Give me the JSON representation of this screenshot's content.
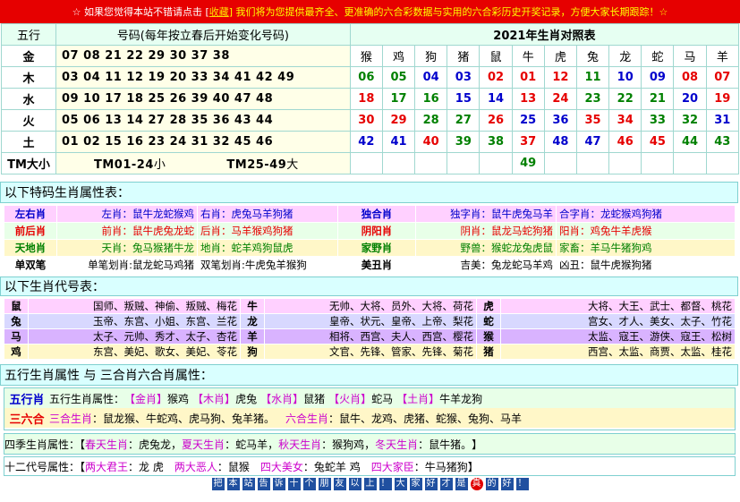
{
  "banner": {
    "prefix": "☆ 如果您觉得本站不错请点击 [",
    "link": "收藏",
    "suffix": "] 我们将为您提供最齐全、更准确的六合彩数据与实用的六合彩历史开奖记录，方便大家长期跟踪！☆"
  },
  "table1": {
    "header": {
      "wuxing": "五行",
      "numbers": "号码(每年按立春后开始变化号码)",
      "year": "2021年生肖对照表"
    },
    "zodiacs": [
      "猴",
      "鸡",
      "狗",
      "猪",
      "鼠",
      "牛",
      "虎",
      "兔",
      "龙",
      "蛇",
      "马",
      "羊"
    ],
    "rows": [
      {
        "wx": "金",
        "nums": "07 08 21 22 29 30 37 38"
      },
      {
        "wx": "木",
        "nums": "03 04 11 12 19 20 33 34 41 42 49"
      },
      {
        "wx": "水",
        "nums": "09 10 17 18 25 26 39 40 47 48"
      },
      {
        "wx": "火",
        "nums": "05 06 13 14 27 28 35 36 43 44"
      },
      {
        "wx": "土",
        "nums": "01 02 15 16 23 24 31 32 45 46"
      }
    ],
    "yearnums": [
      [
        "06",
        "05",
        "04",
        "03",
        "02",
        "01",
        "12",
        "11",
        "10",
        "09",
        "08",
        "07"
      ],
      [
        "18",
        "17",
        "16",
        "15",
        "14",
        "13",
        "24",
        "23",
        "22",
        "21",
        "20",
        "19"
      ],
      [
        "30",
        "29",
        "28",
        "27",
        "26",
        "25",
        "36",
        "35",
        "34",
        "33",
        "32",
        "31"
      ],
      [
        "42",
        "41",
        "40",
        "39",
        "38",
        "37",
        "48",
        "47",
        "46",
        "45",
        "44",
        "43"
      ],
      [
        "",
        "",
        "",
        "",
        "",
        "49",
        "",
        "",
        "",
        "",
        "",
        ""
      ]
    ],
    "yearcolors": [
      [
        "g",
        "g",
        "b",
        "b",
        "r",
        "r",
        "r",
        "g",
        "b",
        "b",
        "r",
        "r"
      ],
      [
        "r",
        "g",
        "g",
        "b",
        "b",
        "r",
        "r",
        "g",
        "g",
        "g",
        "b",
        "r"
      ],
      [
        "r",
        "r",
        "g",
        "g",
        "r",
        "b",
        "b",
        "r",
        "r",
        "g",
        "g",
        "b"
      ],
      [
        "b",
        "b",
        "r",
        "g",
        "g",
        "r",
        "b",
        "b",
        "r",
        "r",
        "g",
        "g"
      ],
      [
        "",
        "",
        "",
        "",
        "",
        "g",
        "",
        "",
        "",
        "",
        "",
        ""
      ]
    ],
    "tm": {
      "label": "TM大小",
      "small": "TM01-24",
      "small_suffix": "小",
      "big": "TM25-49",
      "big_suffix": "大"
    }
  },
  "sec1": "以下特码生肖属性表：",
  "attrs": [
    {
      "a": "左右肖",
      "b": "左肖：鼠牛龙蛇猴鸡",
      "c": "右肖：虎兔马羊狗猪",
      "d": "独合肖",
      "e": "独字肖：鼠牛虎兔马羊",
      "f": "合字肖：龙蛇猴鸡狗猪"
    },
    {
      "a": "前后肖",
      "b": "前肖：鼠牛虎兔龙蛇",
      "c": "后肖：马羊猴鸡狗猪",
      "d": "阴阳肖",
      "e": "阴肖：鼠龙马蛇狗猪",
      "f": "阳肖：鸡兔牛羊虎猴"
    },
    {
      "a": "天地肖",
      "b": "天肖：兔马猴猪牛龙",
      "c": "地肖：蛇羊鸡狗鼠虎",
      "d": "家野肖",
      "e": "野兽：猴蛇龙兔虎鼠",
      "f": "家畜：羊马牛猪狗鸡"
    },
    {
      "a": "单双笔",
      "b": "单笔划肖:鼠龙蛇马鸡猪",
      "c": "双笔划肖:牛虎兔羊猴狗",
      "d": "美丑肖",
      "e": "吉美：兔龙蛇马羊鸡",
      "f": "凶丑：鼠牛虎猴狗猪"
    }
  ],
  "sec2": "以下生肖代号表：",
  "daihao": [
    {
      "a": "鼠",
      "b": "国师、叛贼、神偷、叛贼、梅花",
      "c": "牛",
      "d": "无帅、大将、员外、大将、荷花",
      "e": "虎",
      "f": "大将、大王、武士、都督、桃花"
    },
    {
      "a": "兔",
      "b": "玉帝、东宫、小姐、东宫、兰花",
      "c": "龙",
      "d": "皇帝、状元、皇帝、上帝、梨花",
      "e": "蛇",
      "f": "宫女、才人、美女、太子、竹花"
    },
    {
      "a": "马",
      "b": "太子、元帅、秀才、太子、杏花",
      "c": "羊",
      "d": "相将、西宫、夫人、西宫、樱花",
      "e": "猴",
      "f": "太监、寇王、游侠、寇王、松树"
    },
    {
      "a": "鸡",
      "b": "东宫、美妃、歌女、美妃、苓花",
      "c": "狗",
      "d": "文官、先锋、管家、先锋、菊花",
      "e": "猪",
      "f": "西宫、太监、商贾、太监、桂花"
    }
  ],
  "sec3": "五行生肖属性 与 三合肖六合肖属性：",
  "wuxingline": {
    "label": "五行肖",
    "text0": "五行生肖属性：",
    "items": [
      {
        "tag": "【金肖】",
        "val": "猴鸡"
      },
      {
        "tag": "【木肖】",
        "val": "虎兔"
      },
      {
        "tag": "【水肖】",
        "val": "鼠猪"
      },
      {
        "tag": "【火肖】",
        "val": "蛇马"
      },
      {
        "tag": "【土肖】",
        "val": "牛羊龙狗"
      }
    ]
  },
  "sanheline": {
    "label": "三六合",
    "t1": "三合生肖",
    "v1": "：鼠龙猴、牛蛇鸡、虎马狗、兔羊猪。",
    "t2": "六合生肖",
    "v2": "：鼠牛、龙鸡、虎猪、蛇猴、兔狗、马羊"
  },
  "seasonline": {
    "label": "四季生肖属性：【",
    "s1": "春天生肖",
    "v1": "：虎兔龙，",
    "s2": "夏天生肖",
    "v2": "：蛇马羊，",
    "s3": "秋天生肖",
    "v3": "：猴狗鸡，",
    "s4": "冬天生肖",
    "v4": "：鼠牛猪。",
    "end": "】"
  },
  "zhiline": {
    "label": "十二代号属性：【",
    "s1": "两大君王",
    "v1": "：龙 虎",
    "s2": "两大恶人",
    "v2": "：鼠猴",
    "s3": "四大美女",
    "v3": "：兔蛇羊 鸡",
    "s4": "四大家臣",
    "v4": "：牛马猪狗",
    "end": "】"
  },
  "footer": [
    "把",
    "本",
    "站",
    "告",
    "诉",
    "十",
    "个",
    "朋",
    "友",
    "以",
    "上",
    "！",
    "大",
    "家",
    "好",
    "才",
    "是",
    "真",
    "的",
    "好",
    "！"
  ]
}
